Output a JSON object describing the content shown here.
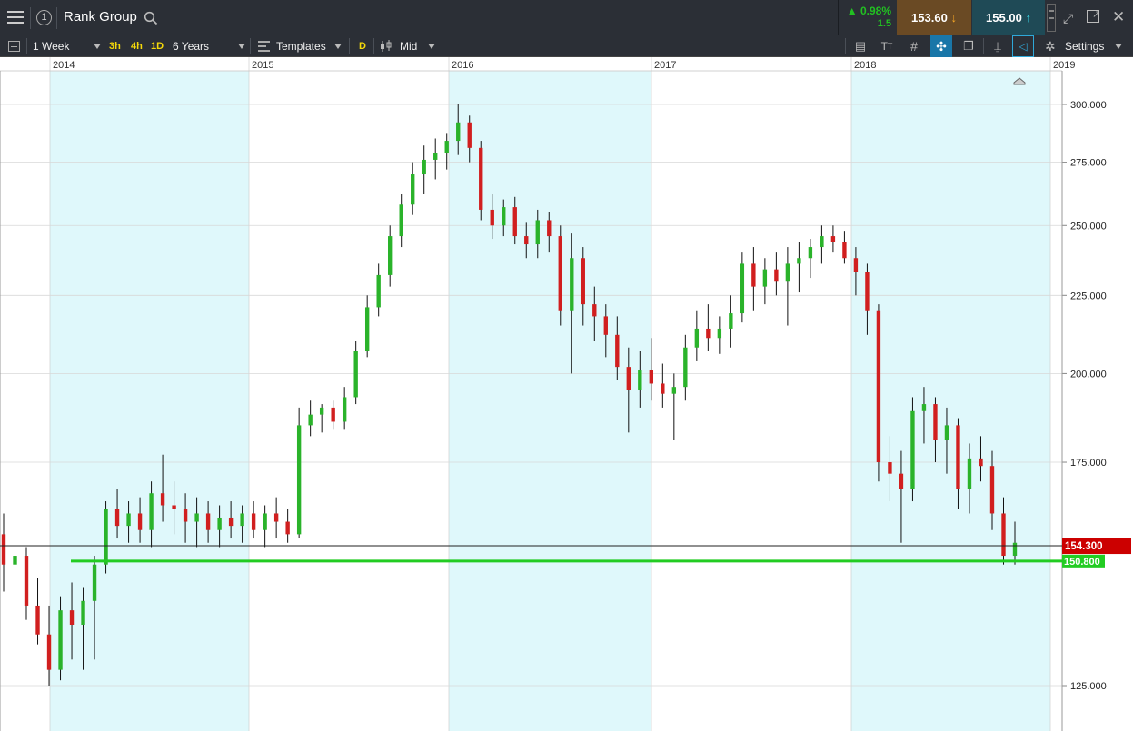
{
  "header": {
    "instrument": "Rank Group",
    "change_pct": "0.98%",
    "change_abs": "1.5",
    "sell_price": "153.60",
    "buy_price": "155.00",
    "colors": {
      "up": "#22c022",
      "sell_bg": "#6a4a24",
      "buy_bg": "#1f4a56"
    }
  },
  "toolbar": {
    "interval": "1 Week",
    "quick_intervals": [
      "3h",
      "4h",
      "1D"
    ],
    "range": "6 Years",
    "templates_label": "Templates",
    "d_label": "D",
    "price_type": "Mid",
    "settings_label": "Settings"
  },
  "chart_data": {
    "type": "candlestick",
    "title": "Rank Group",
    "interval": "1 Week",
    "x_axis_labels": [
      "2014",
      "2015",
      "2016",
      "2017",
      "2018",
      "2019"
    ],
    "y_axis_labels": [
      "300.000",
      "275.000",
      "250.000",
      "225.000",
      "200.000",
      "175.000",
      "125.000"
    ],
    "y_ticks": [
      300,
      275,
      250,
      225,
      200,
      175,
      125
    ],
    "ylim": [
      122,
      315
    ],
    "y_scale": "log",
    "current_price": {
      "value": 154.3,
      "label": "154.300",
      "color": "#cc0000"
    },
    "support_line": {
      "value": 150.8,
      "label": "150.800",
      "color": "#22cc22"
    },
    "colors": {
      "up": "#2ab32a",
      "down": "#d11f1f",
      "wick": "#111111",
      "band": "#dff8fb"
    },
    "candles": [
      [
        157,
        162,
        144,
        150
      ],
      [
        150,
        156,
        145,
        152
      ],
      [
        152,
        154,
        138,
        141
      ],
      [
        141,
        147,
        133,
        135
      ],
      [
        135,
        141,
        125,
        128
      ],
      [
        128,
        143,
        126,
        140
      ],
      [
        140,
        146,
        130,
        137
      ],
      [
        137,
        145,
        128,
        142
      ],
      [
        142,
        152,
        130,
        150
      ],
      [
        150,
        165,
        148,
        163
      ],
      [
        163,
        168,
        156,
        159
      ],
      [
        159,
        165,
        155,
        162
      ],
      [
        162,
        166,
        155,
        158
      ],
      [
        158,
        170,
        154,
        167
      ],
      [
        167,
        177,
        160,
        164
      ],
      [
        164,
        170,
        157,
        163
      ],
      [
        163,
        167,
        155,
        160
      ],
      [
        160,
        166,
        154,
        162
      ],
      [
        162,
        165,
        155,
        158
      ],
      [
        158,
        164,
        154,
        161
      ],
      [
        161,
        165,
        156,
        159
      ],
      [
        159,
        164,
        155,
        162
      ],
      [
        162,
        165,
        156,
        158
      ],
      [
        158,
        164,
        154,
        162
      ],
      [
        162,
        166,
        156,
        160
      ],
      [
        160,
        163,
        155,
        157
      ],
      [
        157,
        190,
        156,
        185
      ],
      [
        185,
        192,
        182,
        188
      ],
      [
        188,
        191,
        183,
        190
      ],
      [
        190,
        192,
        184,
        186
      ],
      [
        186,
        196,
        184,
        193
      ],
      [
        193,
        210,
        191,
        207
      ],
      [
        207,
        225,
        205,
        221
      ],
      [
        221,
        236,
        218,
        232
      ],
      [
        232,
        250,
        228,
        246
      ],
      [
        246,
        262,
        242,
        258
      ],
      [
        258,
        275,
        254,
        270
      ],
      [
        270,
        282,
        262,
        276
      ],
      [
        276,
        285,
        268,
        279
      ],
      [
        279,
        287,
        272,
        284
      ],
      [
        284,
        300,
        278,
        292
      ],
      [
        292,
        295,
        275,
        281
      ],
      [
        281,
        284,
        252,
        256
      ],
      [
        256,
        262,
        245,
        250
      ],
      [
        250,
        260,
        246,
        257
      ],
      [
        257,
        261,
        243,
        246
      ],
      [
        246,
        251,
        238,
        243
      ],
      [
        243,
        256,
        238,
        252
      ],
      [
        252,
        255,
        240,
        246
      ],
      [
        246,
        250,
        215,
        220
      ],
      [
        220,
        247,
        200,
        238
      ],
      [
        238,
        242,
        215,
        222
      ],
      [
        222,
        228,
        210,
        218
      ],
      [
        218,
        222,
        205,
        212
      ],
      [
        212,
        218,
        198,
        202
      ],
      [
        202,
        208,
        183,
        195
      ],
      [
        195,
        207,
        190,
        201
      ],
      [
        201,
        211,
        192,
        197
      ],
      [
        197,
        203,
        190,
        194
      ],
      [
        194,
        200,
        181,
        196
      ],
      [
        196,
        212,
        192,
        208
      ],
      [
        208,
        220,
        204,
        214
      ],
      [
        214,
        222,
        207,
        211
      ],
      [
        211,
        218,
        206,
        214
      ],
      [
        214,
        225,
        208,
        219
      ],
      [
        219,
        240,
        216,
        236
      ],
      [
        236,
        242,
        220,
        228
      ],
      [
        228,
        238,
        222,
        234
      ],
      [
        234,
        240,
        225,
        230
      ],
      [
        230,
        242,
        215,
        236
      ],
      [
        236,
        244,
        226,
        238
      ],
      [
        238,
        245,
        231,
        242
      ],
      [
        242,
        250,
        236,
        246
      ],
      [
        246,
        250,
        240,
        244
      ],
      [
        244,
        248,
        236,
        238
      ],
      [
        238,
        242,
        225,
        233
      ],
      [
        233,
        236,
        212,
        220
      ],
      [
        220,
        222,
        170,
        175
      ],
      [
        175,
        182,
        165,
        172
      ],
      [
        172,
        178,
        155,
        168
      ],
      [
        168,
        193,
        165,
        189
      ],
      [
        189,
        196,
        180,
        191
      ],
      [
        191,
        193,
        175,
        181
      ],
      [
        181,
        190,
        172,
        185
      ],
      [
        185,
        187,
        163,
        168
      ],
      [
        168,
        180,
        162,
        176
      ],
      [
        176,
        182,
        170,
        174
      ],
      [
        174,
        178,
        158,
        162
      ],
      [
        162,
        166,
        150,
        152
      ],
      [
        152,
        160,
        150,
        155
      ]
    ]
  }
}
